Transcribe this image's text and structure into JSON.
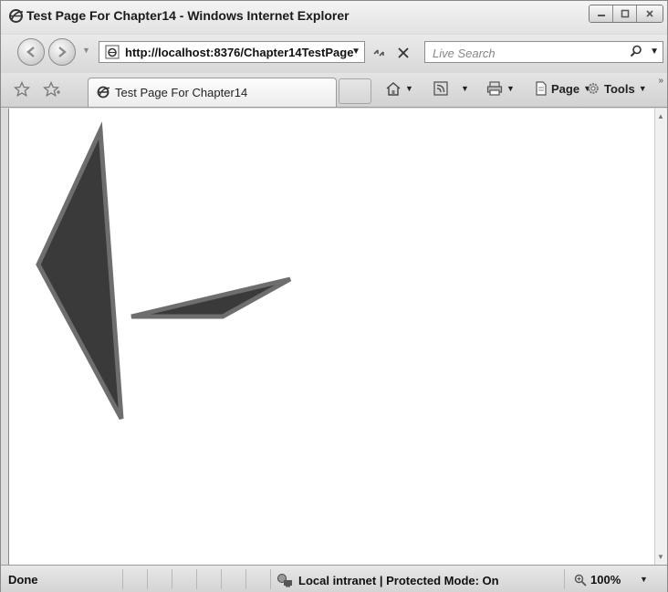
{
  "window": {
    "title": "Test Page For Chapter14 - Windows Internet Explorer"
  },
  "address_bar": {
    "url": "http://localhost:8376/Chapter14TestPage"
  },
  "search": {
    "placeholder": "Live Search"
  },
  "tab": {
    "label": "Test Page For Chapter14"
  },
  "command_bar": {
    "page_label": "Page",
    "tools_label": "Tools"
  },
  "status_bar": {
    "status": "Done",
    "zone": "Local intranet | Protected Mode: On",
    "zoom": "100%"
  },
  "colors": {
    "shape_fill": "#3a3a3a",
    "shape_stroke": "#6e6e6e"
  },
  "icons": {
    "title": "ie-icon",
    "back": "back-arrow-icon",
    "forward": "forward-arrow-icon",
    "refresh": "refresh-icon",
    "stop": "stop-icon",
    "search": "magnifier-icon",
    "favorites": "favorites-star-icon",
    "add_favorites": "add-favorites-icon",
    "home": "home-icon",
    "feeds": "feeds-icon",
    "print": "print-icon",
    "zone": "intranet-globe-icon",
    "zoom": "zoom-magnifier-icon"
  }
}
